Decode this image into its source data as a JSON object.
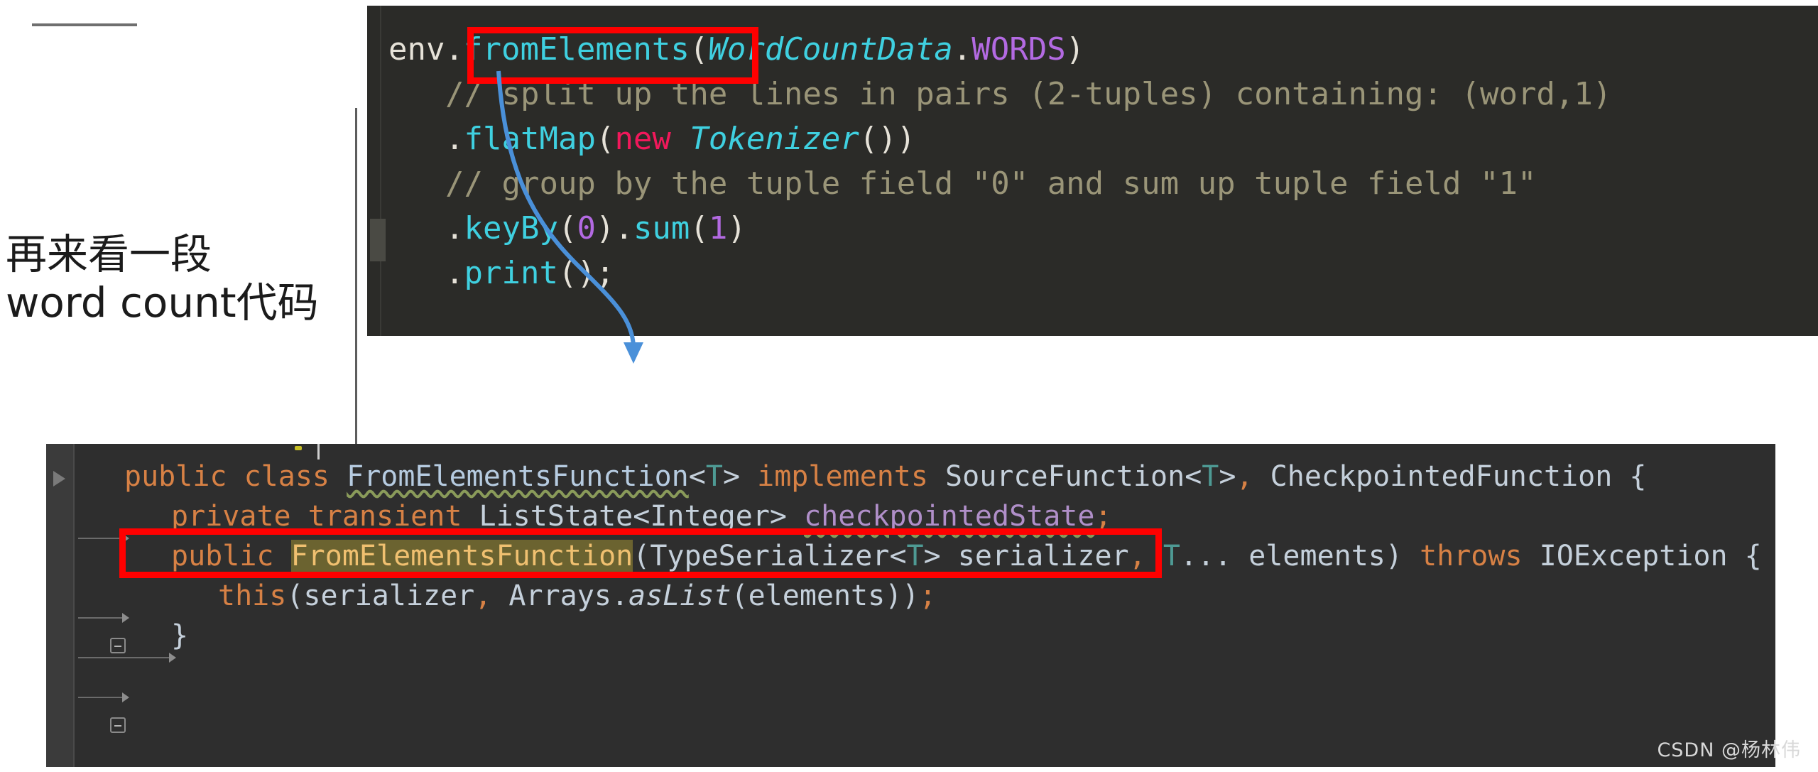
{
  "annotation": {
    "line1": "再来看一段",
    "line2": "word count代码"
  },
  "top_code_panel": {
    "name": "flink-wordcount-snippet",
    "background": "#2b2b28",
    "lines": [
      {
        "tokens": [
          {
            "text": "env",
            "kind": "plain"
          },
          {
            "text": ".",
            "kind": "plain"
          },
          {
            "text": "fromElements",
            "kind": "method"
          },
          {
            "text": "(",
            "kind": "plain"
          },
          {
            "text": "WordCountData",
            "kind": "class"
          },
          {
            "text": ".",
            "kind": "plain"
          },
          {
            "text": "WORDS",
            "kind": "field"
          },
          {
            "text": ")",
            "kind": "plain"
          }
        ]
      },
      {
        "indent": 2,
        "tokens": [
          {
            "text": "// split up the lines in pairs (2-tuples) containing: (word,1)",
            "kind": "comment"
          }
        ]
      },
      {
        "indent": 2,
        "tokens": [
          {
            "text": ".",
            "kind": "plain"
          },
          {
            "text": "flatMap",
            "kind": "method"
          },
          {
            "text": "(",
            "kind": "plain"
          },
          {
            "text": "new ",
            "kind": "kw-new"
          },
          {
            "text": "Tokenizer",
            "kind": "class"
          },
          {
            "text": "())",
            "kind": "plain"
          }
        ]
      },
      {
        "indent": 2,
        "tokens": [
          {
            "text": "// group by the tuple field \"0\" and sum up tuple field \"1\"",
            "kind": "comment"
          }
        ]
      },
      {
        "indent": 2,
        "tokens": [
          {
            "text": ".",
            "kind": "plain"
          },
          {
            "text": "keyBy",
            "kind": "method"
          },
          {
            "text": "(",
            "kind": "plain"
          },
          {
            "text": "0",
            "kind": "num"
          },
          {
            "text": ").",
            "kind": "plain"
          },
          {
            "text": "sum",
            "kind": "method"
          },
          {
            "text": "(",
            "kind": "plain"
          },
          {
            "text": "1",
            "kind": "num"
          },
          {
            "text": ")",
            "kind": "plain"
          }
        ]
      },
      {
        "indent": 2,
        "tokens": [
          {
            "text": ".",
            "kind": "plain"
          },
          {
            "text": "print",
            "kind": "method"
          },
          {
            "text": "();",
            "kind": "plain"
          }
        ]
      }
    ]
  },
  "bottom_code_panel": {
    "name": "FromElementsFunction-source",
    "background": "#2e2e2e",
    "lines": [
      {
        "indent": 0,
        "tokens": [
          {
            "text": "public",
            "kind": "kw"
          },
          {
            "text": " ",
            "kind": "plain"
          },
          {
            "text": "class",
            "kind": "kw"
          },
          {
            "text": " ",
            "kind": "plain"
          },
          {
            "text": "FromElementsFunction",
            "kind": "decl"
          },
          {
            "text": "<",
            "kind": "plain"
          },
          {
            "text": "T",
            "kind": "generic"
          },
          {
            "text": ">",
            "kind": "plain"
          },
          {
            "text": " ",
            "kind": "plain"
          },
          {
            "text": "implements",
            "kind": "kw"
          },
          {
            "text": " ",
            "kind": "plain"
          },
          {
            "text": "SourceFunction",
            "kind": "type"
          },
          {
            "text": "<",
            "kind": "plain"
          },
          {
            "text": "T",
            "kind": "generic"
          },
          {
            "text": ">",
            "kind": "plain"
          },
          {
            "text": ",",
            "kind": "punct"
          },
          {
            "text": " CheckpointedFunction {",
            "kind": "type"
          }
        ]
      },
      {
        "indent": 1,
        "tokens": [
          {
            "text": "private",
            "kind": "kw"
          },
          {
            "text": " ",
            "kind": "plain"
          },
          {
            "text": "transient",
            "kind": "kw"
          },
          {
            "text": " ",
            "kind": "plain"
          },
          {
            "text": "ListState<Integer> ",
            "kind": "type"
          },
          {
            "text": "checkpointedState",
            "kind": "field"
          },
          {
            "text": ";",
            "kind": "punct"
          }
        ]
      },
      {
        "indent": 1,
        "tokens": [
          {
            "text": "public",
            "kind": "kw"
          },
          {
            "text": " ",
            "kind": "plain"
          },
          {
            "text": "FromElementsFunction",
            "kind": "hl"
          },
          {
            "text": "(TypeSerializer<",
            "kind": "type"
          },
          {
            "text": "T",
            "kind": "generic"
          },
          {
            "text": "> serializer",
            "kind": "type"
          },
          {
            "text": ",",
            "kind": "punct"
          },
          {
            "text": " ",
            "kind": "plain"
          },
          {
            "text": "T",
            "kind": "generic"
          },
          {
            "text": "... elements) ",
            "kind": "type"
          },
          {
            "text": "throws",
            "kind": "kw"
          },
          {
            "text": " IOException {",
            "kind": "type"
          }
        ]
      },
      {
        "indent": 2,
        "tokens": [
          {
            "text": "this",
            "kind": "kw"
          },
          {
            "text": "(serializer",
            "kind": "type"
          },
          {
            "text": ",",
            "kind": "punct"
          },
          {
            "text": " Arrays.",
            "kind": "type"
          },
          {
            "text": "asList",
            "kind": "italic"
          },
          {
            "text": "(elements))",
            "kind": "type"
          },
          {
            "text": ";",
            "kind": "punct"
          }
        ]
      },
      {
        "indent": 1,
        "tokens": [
          {
            "text": "}",
            "kind": "type"
          }
        ]
      }
    ]
  },
  "highlights": {
    "color": "#ff0000",
    "box_1_target": "fromElements",
    "box_2_target": "private transient ListState<Integer> checkpointedState;"
  },
  "arrow": {
    "color": "#4a90d9",
    "from": "fromElements",
    "to": "FromElementsFunction class body"
  },
  "watermark": {
    "text": "CSDN @杨林伟"
  }
}
